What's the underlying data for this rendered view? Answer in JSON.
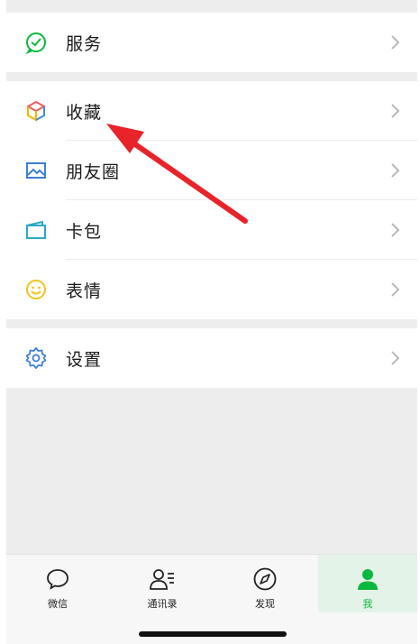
{
  "menu": {
    "service": {
      "label": "服务",
      "icon": "service-check-icon"
    },
    "favorites": {
      "label": "收藏",
      "icon": "favorites-cube-icon"
    },
    "moments": {
      "label": "朋友圈",
      "icon": "moments-picture-icon"
    },
    "cards": {
      "label": "卡包",
      "icon": "card-wallet-icon"
    },
    "stickers": {
      "label": "表情",
      "icon": "smiley-icon"
    },
    "settings": {
      "label": "设置",
      "icon": "gear-icon"
    }
  },
  "tabs": [
    {
      "label": "微信",
      "icon": "chat-bubble-icon",
      "active": false
    },
    {
      "label": "通讯录",
      "icon": "contacts-icon",
      "active": false
    },
    {
      "label": "发现",
      "icon": "compass-icon",
      "active": false
    },
    {
      "label": "我",
      "icon": "person-icon",
      "active": true
    }
  ],
  "colors": {
    "accent": "#09b83e",
    "annotation_arrow": "#e8232a"
  }
}
